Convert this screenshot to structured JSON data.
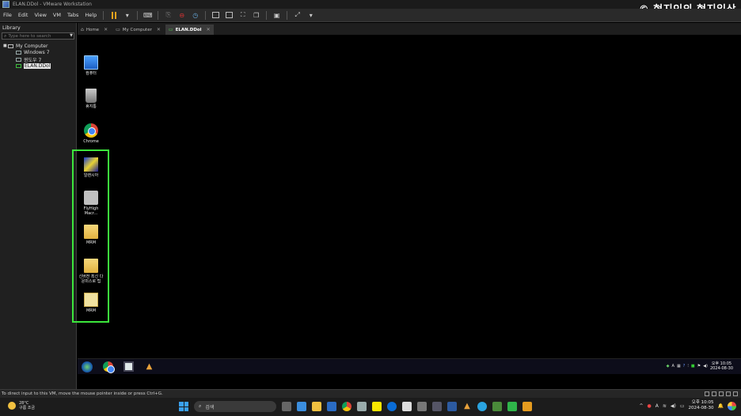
{
  "window": {
    "title": "ELAN.DDol - VMware Workstation",
    "watermark": "© 현지인의 현지일상"
  },
  "menu": [
    "File",
    "Edit",
    "View",
    "VM",
    "Tabs",
    "Help"
  ],
  "library": {
    "title": "Library",
    "search_placeholder": "Type here to search",
    "tree": [
      {
        "label": "My Computer",
        "level": 0
      },
      {
        "label": "Windows 7",
        "level": 1
      },
      {
        "label": "윈도우 7",
        "level": 1
      },
      {
        "label": "ELAN.DDol",
        "level": 1,
        "selected": true
      }
    ]
  },
  "tabs": [
    {
      "label": "Home",
      "icon": "home-icon",
      "active": false
    },
    {
      "label": "My Computer",
      "icon": "monitor-icon",
      "active": false
    },
    {
      "label": "ELAN.DDol",
      "icon": "vm-icon",
      "active": true
    }
  ],
  "desktop_icons": [
    {
      "label": "컴퓨터",
      "icon": "computer-icon"
    },
    {
      "label": "휴지통",
      "icon": "recycle-bin-icon"
    },
    {
      "label": "Chrome",
      "icon": "chrome-icon"
    },
    {
      "label": "일랜시아",
      "icon": "game-icon"
    },
    {
      "label": "FlyHigh Macr...",
      "icon": "flyhigh-icon"
    },
    {
      "label": "MRM",
      "icon": "folder-icon"
    },
    {
      "label": "신버전 최신 다운미스로 팁",
      "icon": "folder-icon"
    },
    {
      "label": "MRM",
      "icon": "mrm-app-icon"
    }
  ],
  "vm_taskbar": {
    "clock_time": "오후 10:05",
    "clock_date": "2024-08-30",
    "tray_lang": "A"
  },
  "statusbar": {
    "message": "To direct input to this VM, move the mouse pointer inside or press Ctrl+G."
  },
  "host_taskbar": {
    "weather_temp": "28°C",
    "weather_desc": "구름 조금",
    "search_label": "검색",
    "tray_lang": "A",
    "clock_time": "오후 10:05",
    "clock_date": "2024-08-30"
  },
  "colors": {
    "highlight_box": "#3ce63c",
    "pause": "#f4a21d"
  }
}
